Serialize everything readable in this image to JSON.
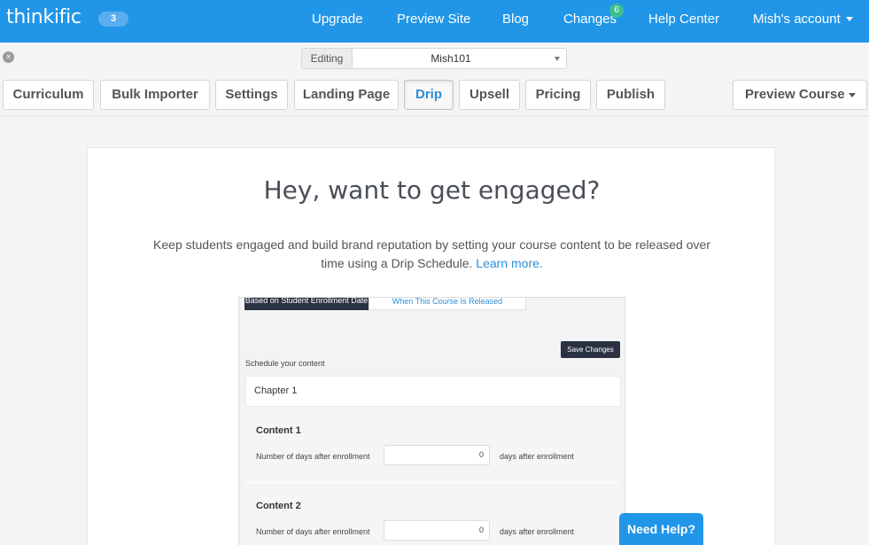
{
  "topbar": {
    "logo": "thinkific",
    "count_badge": "3",
    "nav": {
      "upgrade": "Upgrade",
      "preview_site": "Preview Site",
      "blog": "Blog",
      "changes": "Changes",
      "changes_count": "6",
      "help_center": "Help Center",
      "account": "Mish's account"
    },
    "color": "#2196e8"
  },
  "editing": {
    "label": "Editing",
    "value": "Mish101",
    "close_icon": "close-icon"
  },
  "tabs": {
    "curriculum": "Curriculum",
    "bulk_importer": "Bulk Importer",
    "settings": "Settings",
    "landing_page": "Landing Page",
    "drip": "Drip",
    "upsell": "Upsell",
    "pricing": "Pricing",
    "publish": "Publish",
    "preview_course": "Preview Course",
    "active": "Drip"
  },
  "main": {
    "heading": "Hey, want to get engaged?",
    "description": "Keep students engaged and build brand reputation by setting your course content to be released over time using a Drip Schedule.",
    "learn_more": "Learn more."
  },
  "preview": {
    "tab_enrollment": "Based on Student Enrollment Date",
    "tab_released": "When This Course Is Released",
    "save_changes": "Save Changes",
    "schedule_label": "Schedule your content",
    "chapter": "Chapter 1",
    "contents": [
      {
        "title": "Content 1",
        "label": "Number of days after enrollment",
        "value": "0",
        "after": "days after enrollment"
      },
      {
        "title": "Content 2",
        "label": "Number of days after enrollment",
        "value": "0",
        "after": "days after enrollment"
      }
    ]
  },
  "help": {
    "label": "Need Help?"
  }
}
